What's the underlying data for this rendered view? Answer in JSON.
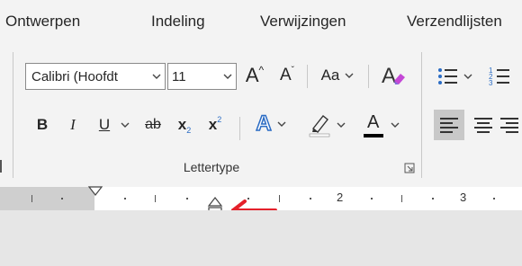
{
  "tabs": [
    "Ontwerpen",
    "Indeling",
    "Verwijzingen",
    "Verzendlijsten"
  ],
  "font": {
    "name": "Calibri (Hoofdt",
    "size": "11",
    "grow_label": "A",
    "shrink_label": "A",
    "case_label": "Aa",
    "group_label": "Lettertype"
  },
  "format": {
    "bold": "B",
    "italic": "I",
    "underline": "U",
    "strike": "ab",
    "subscript": "x",
    "sub_mark": "2",
    "superscript": "x",
    "sup_mark": "2",
    "text_effect": "A",
    "font_color": "A"
  },
  "ruler": {
    "numbers": [
      "1",
      "2",
      "3"
    ]
  },
  "colors": {
    "arrow": "#e4212b",
    "font_color_bar": "#000000",
    "highlight_bar": "#ffffff"
  }
}
